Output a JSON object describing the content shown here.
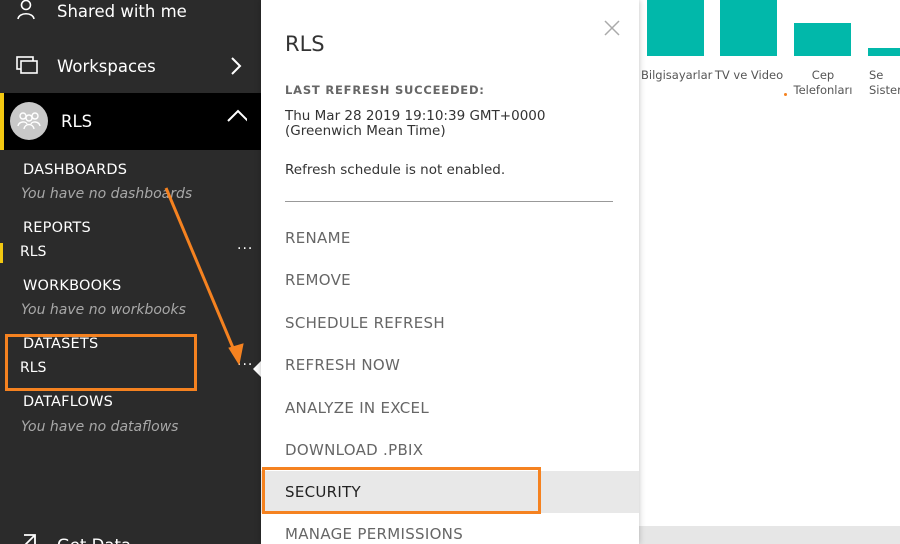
{
  "sidebar": {
    "shared": {
      "label": "Shared with me",
      "icon": "people-icon"
    },
    "workspaces": {
      "label": "Workspaces",
      "icon": "workspaces-icon"
    },
    "workspace": {
      "label": "RLS",
      "icon": "group-avatar-icon"
    },
    "sections": {
      "dashboards": {
        "title": "DASHBOARDS",
        "empty": "You have no dashboards"
      },
      "reports": {
        "title": "REPORTS",
        "item": "RLS",
        "more": "···"
      },
      "workbooks": {
        "title": "WORKBOOKS",
        "empty": "You have no workbooks"
      },
      "datasets": {
        "title": "DATASETS",
        "item": "RLS",
        "more": "···"
      },
      "dataflows": {
        "title": "DATAFLOWS",
        "empty": "You have no dataflows"
      }
    },
    "get_data": {
      "label": "Get Data",
      "icon": "arrow-northeast-icon"
    }
  },
  "panel": {
    "title": "RLS",
    "refresh_label": "LAST REFRESH SUCCEEDED:",
    "refresh_date": "Thu Mar 28 2019 19:10:39 GMT+0000 (Greenwich Mean Time)",
    "schedule_note": "Refresh schedule is not enabled.",
    "menu": [
      "RENAME",
      "REMOVE",
      "SCHEDULE REFRESH",
      "REFRESH NOW",
      "ANALYZE IN EXCEL",
      "DOWNLOAD .PBIX",
      "SECURITY",
      "MANAGE PERMISSIONS"
    ]
  },
  "chart": {
    "labels": [
      "Bilgisayarlar",
      "TV ve Video",
      "Cep Telefonları",
      "Se Sister"
    ],
    "bar_color": "#01b8aa"
  },
  "colors": {
    "sidebar_bg": "#2b2b2b",
    "accent_yellow": "#f2c811",
    "annotation_orange": "#f58220"
  }
}
